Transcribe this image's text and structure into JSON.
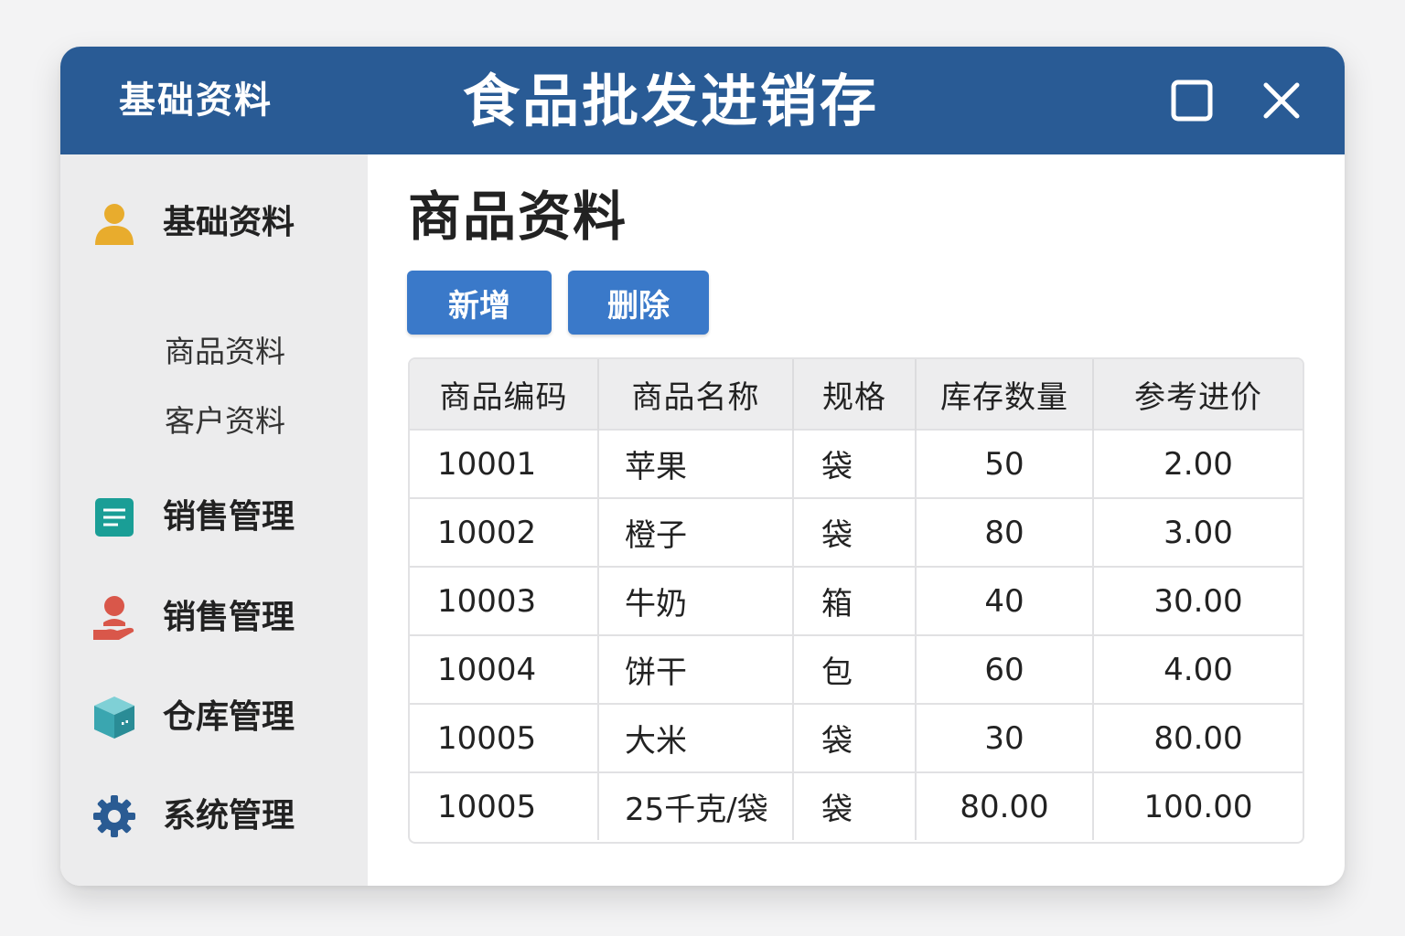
{
  "titlebar": {
    "left_label": "基础资料",
    "title": "食品批发进销存"
  },
  "sidebar": {
    "items": [
      {
        "label": "基础资料",
        "icon": "user-icon",
        "color": "#e8ac2d"
      },
      {
        "label": "销售管理",
        "icon": "document-icon",
        "color": "#1a9e96"
      },
      {
        "label": "销售管理",
        "icon": "hand-user-icon",
        "color": "#d9574a"
      },
      {
        "label": "仓库管理",
        "icon": "box-icon",
        "color": "#3aa6b0"
      },
      {
        "label": "系统管理",
        "icon": "gear-icon",
        "color": "#2a5b93"
      }
    ],
    "subitems": [
      {
        "label": "商品资料"
      },
      {
        "label": "客户资料"
      }
    ]
  },
  "main": {
    "page_title": "商品资料",
    "add_label": "新增",
    "delete_label": "删除",
    "table": {
      "headers": [
        "商品编码",
        "商品名称",
        "规格",
        "库存数量",
        "参考进价"
      ],
      "rows": [
        [
          "10001",
          "苹果",
          "袋",
          "50",
          "2.00"
        ],
        [
          "10002",
          "橙子",
          "袋",
          "80",
          "3.00"
        ],
        [
          "10003",
          "牛奶",
          "箱",
          "40",
          "30.00"
        ],
        [
          "10004",
          "饼干",
          "包",
          "60",
          "4.00"
        ],
        [
          "10005",
          "大米",
          "袋",
          "30",
          "80.00"
        ],
        [
          "10005",
          "25千克/袋",
          "袋",
          "80.00",
          "100.00"
        ]
      ]
    }
  },
  "colors": {
    "titlebar": "#295b95",
    "button": "#3a79c9",
    "sidebar": "#ececed"
  }
}
